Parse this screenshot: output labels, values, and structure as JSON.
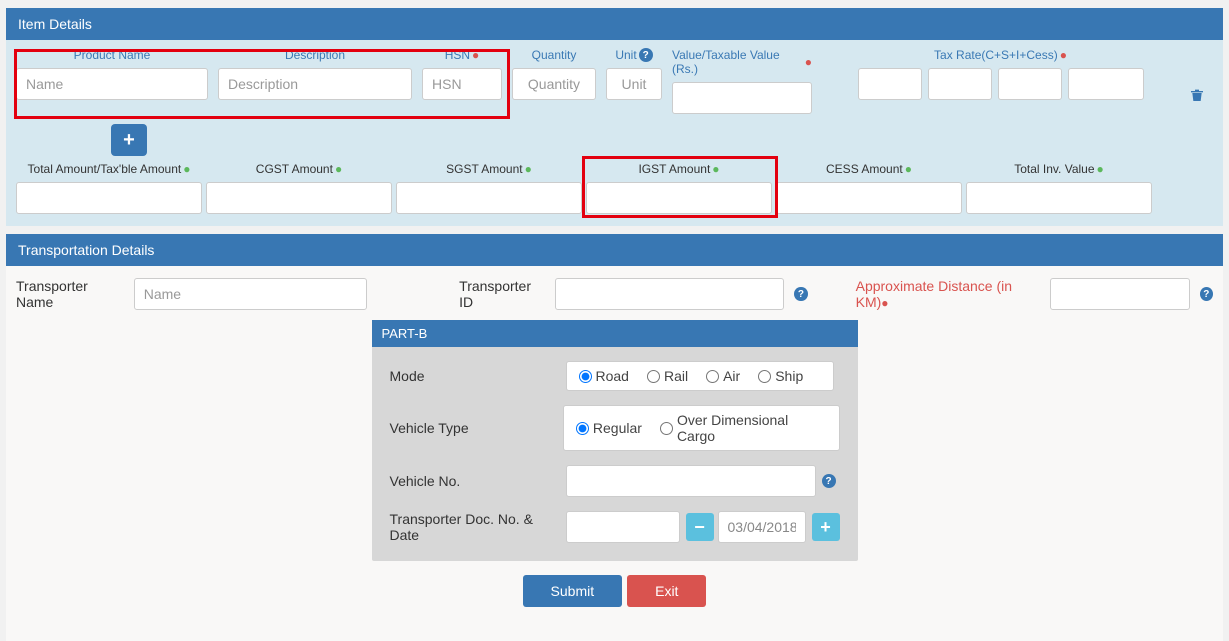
{
  "item": {
    "title": "Item Details",
    "labels": {
      "product": "Product Name",
      "description": "Description",
      "hsn": "HSN",
      "quantity": "Quantity",
      "unit": "Unit",
      "value": "Value/Taxable Value (Rs.)",
      "taxrate": "Tax Rate(C+S+I+Cess)"
    },
    "placeholders": {
      "name": "Name",
      "description": "Description",
      "hsn": "HSN",
      "quantity": "Quantity",
      "unit": "Unit"
    },
    "totals": {
      "total_amount": "Total Amount/Tax'ble Amount",
      "cgst": "CGST Amount",
      "sgst": "SGST Amount",
      "igst": "IGST Amount",
      "cess": "CESS Amount",
      "total_inv": "Total Inv. Value"
    }
  },
  "transport": {
    "title": "Transportation Details",
    "labels": {
      "name": "Transporter Name",
      "id": "Transporter ID",
      "distance": "Approximate Distance (in KM)"
    },
    "placeholder_name": "Name"
  },
  "partb": {
    "title": "PART-B",
    "labels": {
      "mode": "Mode",
      "vehicle_type": "Vehicle Type",
      "vehicle_no": "Vehicle No.",
      "doc": "Transporter Doc. No. & Date"
    },
    "mode_options": [
      "Road",
      "Rail",
      "Air",
      "Ship"
    ],
    "vehicle_options": [
      "Regular",
      "Over Dimensional Cargo"
    ],
    "doc_date": "03/04/2018"
  },
  "buttons": {
    "submit": "Submit",
    "exit": "Exit"
  }
}
